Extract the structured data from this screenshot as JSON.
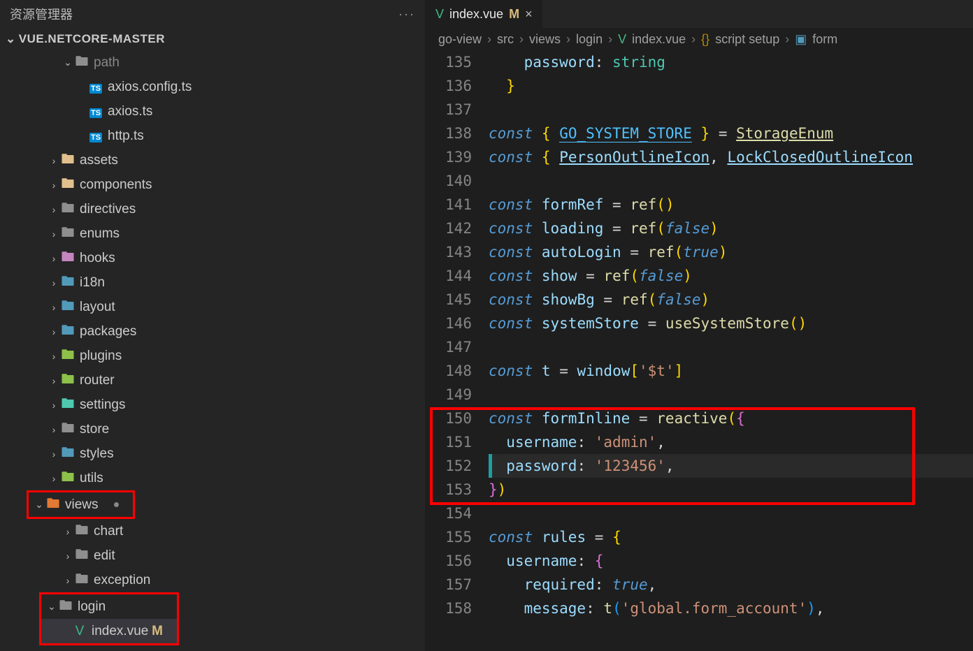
{
  "sidebar": {
    "title": "资源管理器",
    "project": "VUE.NETCORE-MASTER",
    "items": [
      {
        "depth": 3,
        "chev": "down",
        "icon": "folder",
        "color": "ic-grey",
        "label": "path",
        "dim": true
      },
      {
        "depth": 4,
        "icon": "ts",
        "label": "axios.config.ts"
      },
      {
        "depth": 4,
        "icon": "ts",
        "label": "axios.ts"
      },
      {
        "depth": 4,
        "icon": "ts",
        "label": "http.ts"
      },
      {
        "depth": 2,
        "chev": "right",
        "icon": "folder",
        "color": "ic-yellow",
        "label": "assets"
      },
      {
        "depth": 2,
        "chev": "right",
        "icon": "folder",
        "color": "ic-yellow",
        "label": "components"
      },
      {
        "depth": 2,
        "chev": "right",
        "icon": "folder",
        "color": "ic-grey",
        "label": "directives"
      },
      {
        "depth": 2,
        "chev": "right",
        "icon": "folder",
        "color": "ic-grey",
        "label": "enums"
      },
      {
        "depth": 2,
        "chev": "right",
        "icon": "folder",
        "color": "ic-purple",
        "label": "hooks"
      },
      {
        "depth": 2,
        "chev": "right",
        "icon": "folder",
        "color": "ic-blue",
        "label": "i18n"
      },
      {
        "depth": 2,
        "chev": "right",
        "icon": "folder",
        "color": "ic-blue",
        "label": "layout"
      },
      {
        "depth": 2,
        "chev": "right",
        "icon": "folder",
        "color": "ic-blue",
        "label": "packages"
      },
      {
        "depth": 2,
        "chev": "right",
        "icon": "folder",
        "color": "ic-green",
        "label": "plugins"
      },
      {
        "depth": 2,
        "chev": "right",
        "icon": "folder",
        "color": "ic-green",
        "label": "router"
      },
      {
        "depth": 2,
        "chev": "right",
        "icon": "folder",
        "color": "ic-teal",
        "label": "settings"
      },
      {
        "depth": 2,
        "chev": "right",
        "icon": "folder",
        "color": "ic-grey",
        "label": "store"
      },
      {
        "depth": 2,
        "chev": "right",
        "icon": "folder",
        "color": "ic-blue",
        "label": "styles"
      },
      {
        "depth": 2,
        "chev": "right",
        "icon": "folder",
        "color": "ic-green",
        "label": "utils"
      },
      {
        "depth": 2,
        "chev": "down",
        "icon": "folder",
        "color": "ic-orange",
        "label": "views",
        "redbox": true,
        "unsavedDot": true
      },
      {
        "depth": 3,
        "chev": "right",
        "icon": "folder",
        "color": "ic-grey",
        "label": "chart"
      },
      {
        "depth": 3,
        "chev": "right",
        "icon": "folder",
        "color": "ic-grey",
        "label": "edit"
      },
      {
        "depth": 3,
        "chev": "right",
        "icon": "folder",
        "color": "ic-grey",
        "label": "exception"
      },
      {
        "depth": 3,
        "chev": "down",
        "icon": "folder",
        "color": "ic-grey",
        "label": "login",
        "redbox": true,
        "boxStart": true
      },
      {
        "depth": 4,
        "icon": "vue",
        "label": "index.vue",
        "redbox": true,
        "boxEnd": true,
        "selected": true,
        "mod": "M"
      }
    ]
  },
  "tab": {
    "filename": "index.vue",
    "mod": "M"
  },
  "breadcrumbs": [
    "go-view",
    "src",
    "views",
    "login",
    "index.vue",
    "script setup",
    "form"
  ],
  "breadcrumbIcons": [
    "",
    "",
    "",
    "",
    "vue",
    "braces",
    "var"
  ],
  "gutter": [
    "135",
    "136",
    "137",
    "138",
    "139",
    "140",
    "141",
    "142",
    "143",
    "144",
    "145",
    "146",
    "147",
    "148",
    "149",
    "150",
    "151",
    "152",
    "153",
    "154",
    "155",
    "156",
    "157",
    "158"
  ],
  "code": {
    "l135": {
      "kw": "",
      "txt": "    password",
      "punc": ":",
      "type": " string"
    },
    "l136": {
      "ypunc": "}"
    },
    "l138_kw": "const",
    "l138_a": "GO_SYSTEM_STORE",
    "l138_b": "StorageEnum",
    "l139_kw": "const",
    "l139_a": "PersonOutlineIcon",
    "l139_b": "LockClosedOutlineIcon",
    "l141": {
      "kw": "const",
      "id": "formRef",
      "fn": "ref"
    },
    "l142": {
      "kw": "const",
      "id": "loading",
      "fn": "ref",
      "arg": "false"
    },
    "l143": {
      "kw": "const",
      "id": "autoLogin",
      "fn": "ref",
      "arg": "true"
    },
    "l144": {
      "kw": "const",
      "id": "show",
      "fn": "ref",
      "arg": "false"
    },
    "l145": {
      "kw": "const",
      "id": "showBg",
      "fn": "ref",
      "arg": "false"
    },
    "l146": {
      "kw": "const",
      "id": "systemStore",
      "fn": "useSystemStore"
    },
    "l148": {
      "kw": "const",
      "id": "t",
      "expr": "window",
      "key": "'$t'"
    },
    "l150": {
      "kw": "const",
      "id": "formInline",
      "fn": "reactive"
    },
    "l151": {
      "key": "username",
      "val": "'admin'"
    },
    "l152": {
      "key": "password",
      "val": "'123456'"
    },
    "l155": {
      "kw": "const",
      "id": "rules"
    },
    "l156": {
      "key": "username"
    },
    "l157": {
      "key": "required",
      "val": "true"
    },
    "l158": {
      "key": "message",
      "fn": "t",
      "arg": "'global.form_account'"
    }
  }
}
